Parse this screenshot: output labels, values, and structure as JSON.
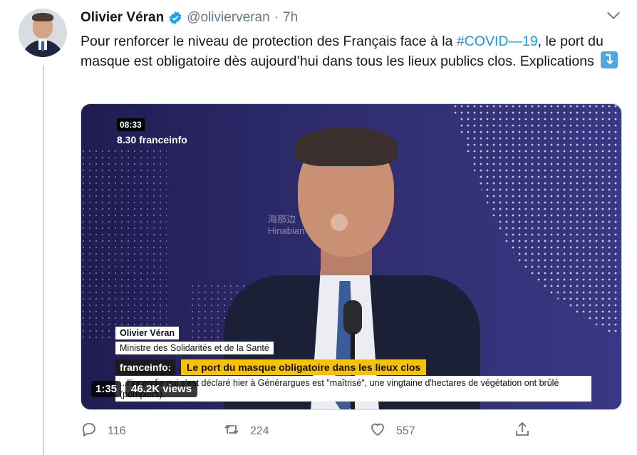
{
  "author": {
    "name": "Olivier Véran",
    "handle": "@olivierveran",
    "separator": "·",
    "time": "7h"
  },
  "tweet": {
    "text_before": "Pour renforcer le niveau de protection des Français face à la ",
    "hashtag": "#COVID—19",
    "text_after": ", le port du masque est obligatoire dès aujourd’hui dans tous les lieux publics clos. Explications"
  },
  "video": {
    "clock": "08:33",
    "program": "8.30 franceinfo",
    "speaker_name": "Olivier Véran",
    "speaker_title": "Ministre des Solidarités et de la Santé",
    "ticker_brand": "franceinfo:",
    "ticker_headline": "Le port du masque obligatoire dans les lieux clos",
    "ticker_line": "...l'incendie qui s'est déclaré hier à Générargues est \"maîtrisé\", une vingtaine d'hectares de végétation ont brûlé (pompiers).",
    "watermark_cn": "海那边",
    "watermark_en": "Hinabian",
    "duration": "1:35",
    "views": "46.2K views"
  },
  "actions": {
    "replies": "116",
    "retweets": "224",
    "likes": "557"
  },
  "colors": {
    "link": "#1b95e0",
    "muted": "#657786",
    "verified": "#1da1f2"
  },
  "icons": [
    "verified-badge-icon",
    "chevron-down-icon",
    "arrow-down-icon",
    "reply-icon",
    "retweet-icon",
    "like-icon",
    "share-icon"
  ]
}
